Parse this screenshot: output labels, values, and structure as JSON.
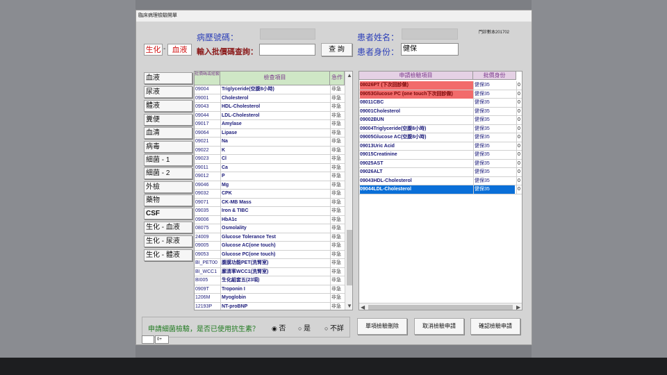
{
  "window": {
    "title": "臨床病理檢驗開單"
  },
  "header": {
    "chart_no_label": "病歷號碼：",
    "patient_name_label": "患者姓名：",
    "clinic_label": "門診數本201702",
    "batch_query_label": "輸入批價碼查詢：",
    "query_button": "查 詢",
    "identity_label": "患者身份：",
    "identity_value": "健保",
    "tag_left": "生化",
    "tag_sep": "-",
    "tag_right": "血液"
  },
  "categories": [
    "血液",
    "尿液",
    "體液",
    "糞便",
    "血清",
    "病毒",
    "細菌 - 1",
    "細菌 - 2",
    "外檢",
    "藥物",
    "CSF",
    "生化 - 血液",
    "生化 - 尿液",
    "生化 - 體液"
  ],
  "left_table": {
    "headers": [
      "批價碼或組套",
      "檢查項目",
      "急作"
    ],
    "rows": [
      [
        "09004",
        "Triglyceride(空腹8小時)",
        "非急"
      ],
      [
        "09001",
        "Cholesterol",
        "非急"
      ],
      [
        "09043",
        "HDL-Cholesterol",
        "非急"
      ],
      [
        "09044",
        "LDL-Cholesterol",
        "非急"
      ],
      [
        "09017",
        "Amylase",
        "非急"
      ],
      [
        "09064",
        "Lipase",
        "非急"
      ],
      [
        "09021",
        "Na",
        "非急"
      ],
      [
        "09022",
        "K",
        "非急"
      ],
      [
        "09023",
        "Cl",
        "非急"
      ],
      [
        "09011",
        "Ca",
        "非急"
      ],
      [
        "09012",
        "P",
        "非急"
      ],
      [
        "09046",
        "Mg",
        "非急"
      ],
      [
        "09032",
        "CPK",
        "非急"
      ],
      [
        "09071",
        "CK-MB Mass",
        "非急"
      ],
      [
        "09035",
        "Iron & TIBC",
        "非急"
      ],
      [
        "09006",
        "HbA1c",
        "非急"
      ],
      [
        "08075",
        "Osmolality",
        "非急"
      ],
      [
        "24009",
        "Glucose Tolerance Test",
        "非急"
      ],
      [
        "09005",
        "Glucose AC(one touch)",
        "非急"
      ],
      [
        "09053",
        "Glucose PC(one touch)",
        "非急"
      ],
      [
        "BI_PET00",
        "腹膜功能PET(洗腎室)",
        "非急"
      ],
      [
        "BI_WCC1",
        "廓清率WCC1(洗腎室)",
        "非急"
      ],
      [
        "BI005",
        "生化組套五(23項)",
        "非急"
      ],
      [
        "0909T",
        "Troponin I",
        "非急"
      ],
      [
        "1206M",
        "Myoglobin",
        "非急"
      ],
      [
        "12193P",
        "NT-proBNP",
        "非急"
      ]
    ]
  },
  "right_table": {
    "headers": [
      "申請檢驗項目",
      "批價身份"
    ],
    "rows": [
      [
        "08026PT (下次回診做)",
        "健保35",
        "0"
      ],
      [
        "09053Glucose PC (one touch下次回診做)",
        "健保35",
        "0"
      ],
      [
        "08011CBC",
        "健保35",
        "0"
      ],
      [
        "09001Cholesterol",
        "健保35",
        "0"
      ],
      [
        "09002BUN",
        "健保35",
        "0"
      ],
      [
        "09004Triglyceride(空腹8小時)",
        "健保35",
        "0"
      ],
      [
        "09005Glucose AC(空腹8小時)",
        "健保35",
        "0"
      ],
      [
        "09013Uric Acid",
        "健保35",
        "0"
      ],
      [
        "09015Creatinine",
        "健保35",
        "0"
      ],
      [
        "09025AST",
        "健保35",
        "0"
      ],
      [
        "09026ALT",
        "健保35",
        "0"
      ],
      [
        "09043HDL-Cholesterol",
        "健保35",
        "0"
      ],
      [
        "09044LDL-Cholesterol",
        "健保35",
        "0"
      ]
    ]
  },
  "antibiotic": {
    "question": "申請細菌檢驗，是否已使用抗生素？",
    "options": [
      "否",
      "是",
      "不詳"
    ],
    "selected": "否"
  },
  "buttons": {
    "delete_one": "單項檢驗刪除",
    "cancel": "取消檢驗申請",
    "confirm": "確認檢驗申請"
  },
  "status": {
    "cell2": "0+"
  },
  "colors": {
    "highlight_red": "#f26b6b",
    "selected_blue": "#0a6fd8",
    "grid_header_green": "#cfe7c6",
    "grid_header_purple": "#e5d1e5"
  }
}
